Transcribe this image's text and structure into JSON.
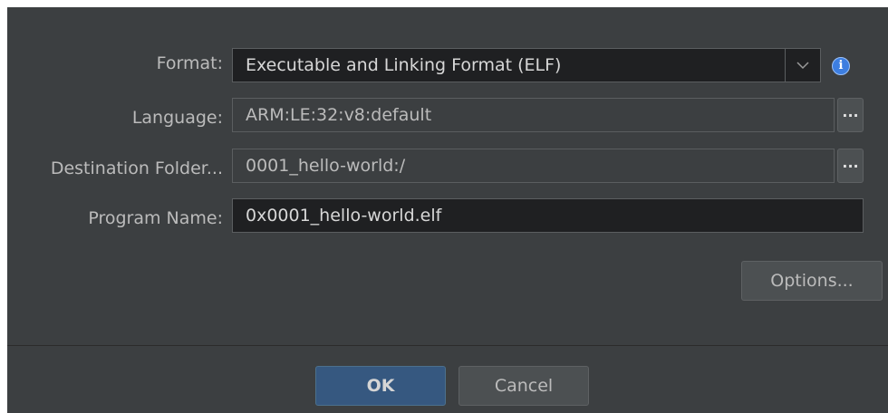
{
  "form": {
    "format": {
      "label": "Format:",
      "value": "Executable and Linking Format (ELF)",
      "info_icon": "info-icon",
      "info_glyph": "i"
    },
    "language": {
      "label": "Language:",
      "value": "ARM:LE:32:v8:default",
      "browse_label": "..."
    },
    "destination": {
      "label": "Destination Folder...",
      "value": "0001_hello-world:/",
      "browse_label": "..."
    },
    "program_name": {
      "label": "Program Name:",
      "value": "0x0001_hello-world.elf"
    }
  },
  "buttons": {
    "options": "Options...",
    "ok": "OK",
    "cancel": "Cancel"
  },
  "colors": {
    "dialog_bg": "#3c3f41",
    "field_dark_bg": "#1f2022",
    "primary_button": "#365880",
    "info_icon": "#3d7ee0"
  }
}
